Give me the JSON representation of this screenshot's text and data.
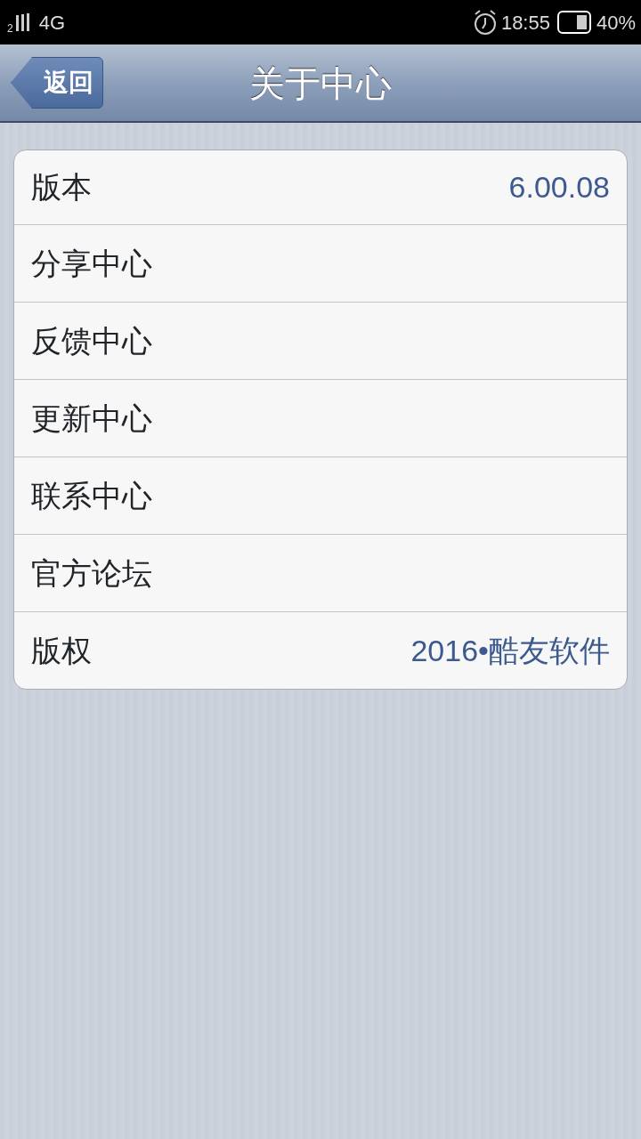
{
  "status_bar": {
    "sim": "2",
    "network": "4G",
    "time": "18:55",
    "battery": "40%"
  },
  "nav_bar": {
    "back_button": "返回",
    "title": "关于中心"
  },
  "rows": [
    {
      "label": "版本",
      "value": "6.00.08"
    },
    {
      "label": "分享中心"
    },
    {
      "label": "反馈中心"
    },
    {
      "label": "更新中心"
    },
    {
      "label": "联系中心"
    },
    {
      "label": "官方论坛"
    },
    {
      "label": "版权",
      "value": "2016•酷友软件"
    }
  ]
}
